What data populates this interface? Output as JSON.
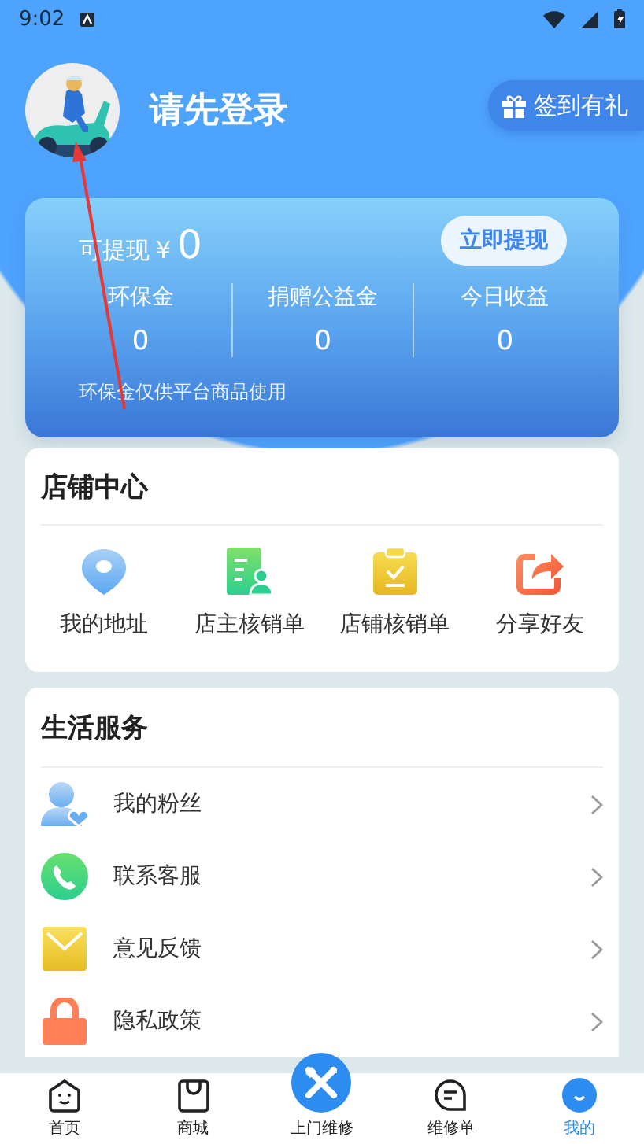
{
  "status_bar": {
    "time": "9:02"
  },
  "profile": {
    "name": "请先登录",
    "sign_in_button": "签到有礼"
  },
  "wallet": {
    "label": "可提现",
    "currency": "¥",
    "amount": "0",
    "withdraw_button": "立即提现",
    "note": "环保金仅供平台商品使用",
    "stats": [
      {
        "label": "环保金",
        "value": "0"
      },
      {
        "label": "捐赠公益金",
        "value": "0"
      },
      {
        "label": "今日收益",
        "value": "0"
      }
    ]
  },
  "shop_center": {
    "title": "店铺中心",
    "items": [
      {
        "label": "我的地址",
        "kind": "location"
      },
      {
        "label": "店主核销单",
        "kind": "owner-order"
      },
      {
        "label": "店铺核销单",
        "kind": "clipboard"
      },
      {
        "label": "分享好友",
        "kind": "share"
      }
    ]
  },
  "life_services": {
    "title": "生活服务",
    "items": [
      {
        "label": "我的粉丝",
        "kind": "fans"
      },
      {
        "label": "联系客服",
        "kind": "phone"
      },
      {
        "label": "意见反馈",
        "kind": "mail"
      },
      {
        "label": "隐私政策",
        "kind": "lock"
      }
    ]
  },
  "tab_bar": [
    {
      "label": "首页",
      "kind": "home",
      "selected": false
    },
    {
      "label": "商城",
      "kind": "shop",
      "selected": false
    },
    {
      "label": "上门维修",
      "kind": "repair",
      "selected": false
    },
    {
      "label": "维修单",
      "kind": "orders",
      "selected": false
    },
    {
      "label": "我的",
      "kind": "me",
      "selected": true
    }
  ]
}
